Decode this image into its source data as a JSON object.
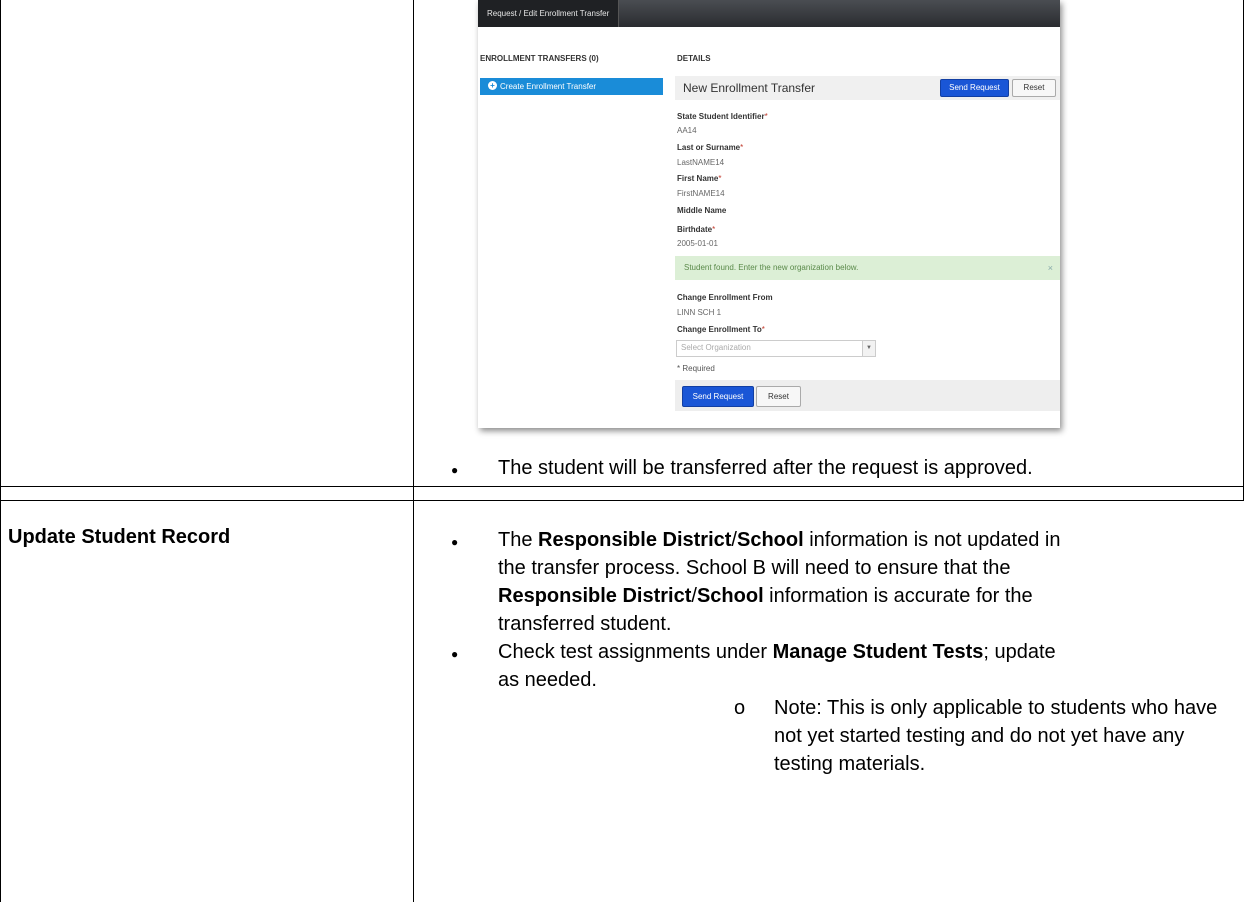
{
  "screenshot": {
    "tab_label": "Request / Edit Enrollment Transfer",
    "left_heading": "ENROLLMENT TRANSFERS (0)",
    "create_button": "Create Enrollment Transfer",
    "details_heading": "DETAILS",
    "form_title": "New Enrollment Transfer",
    "send_request_label": "Send Request",
    "reset_label": "Reset",
    "required_marker": "*",
    "fields": {
      "ssid_label": "State Student Identifier",
      "ssid_value": "AA14",
      "last_label": "Last or Surname",
      "last_value": "LastNAME14",
      "first_label": "First Name",
      "first_value": "FirstNAME14",
      "middle_label": "Middle Name",
      "birth_label": "Birthdate",
      "birth_value": "2005-01-01"
    },
    "alert_text": "Student found. Enter the new organization below.",
    "alert_close": "×",
    "change_from_label": "Change Enrollment From",
    "change_from_value": "LINN SCH 1",
    "change_to_label": "Change Enrollment To",
    "select_placeholder": "Select Organization",
    "select_arrow": "▼",
    "required_note": "* Required"
  },
  "doc": {
    "bullet_char": "●",
    "sub_bullet_char": "o",
    "row1_bullet": "The student will be transferred after the request is approved.",
    "row2_heading": "Update Student Record",
    "row2_b1": {
      "t1": "The ",
      "b1": "Responsible District",
      "t2": "/",
      "b2": "School",
      "t3": " information is not updated in",
      "line2": "the transfer process. School B will need to ensure that the",
      "b3": "Responsible District",
      "t4": "/",
      "b4": "School",
      "t5": " information is accurate for the",
      "line4": "transferred student."
    },
    "row2_b2": {
      "t1": "Check test assignments under ",
      "b1": "Manage Student Tests",
      "t2": "; update",
      "line2": "as needed."
    },
    "row2_sub": {
      "line1": "Note: This is only applicable to students who have",
      "line2": "not yet started testing and do not yet have any",
      "line3": "testing materials."
    }
  }
}
